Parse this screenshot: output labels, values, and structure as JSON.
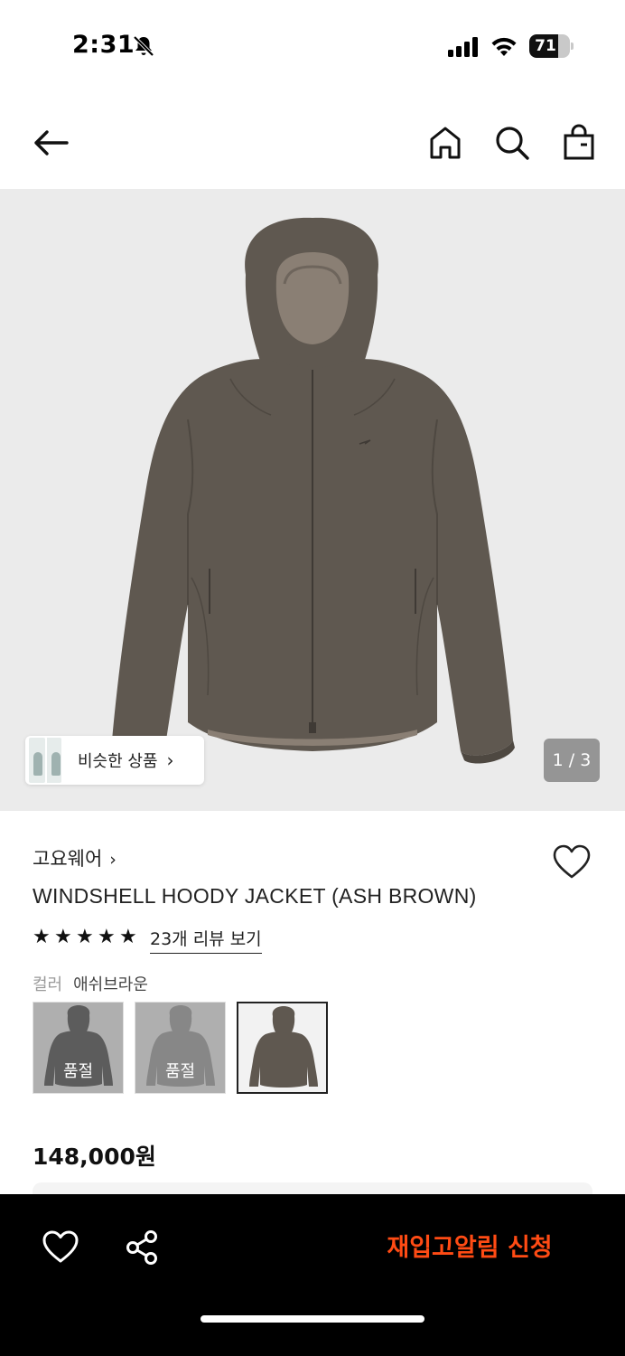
{
  "status_bar": {
    "time": "2:31",
    "battery_level": "71",
    "battery_fraction": 0.71
  },
  "nav": {
    "icons": [
      "back-arrow-icon",
      "home-icon",
      "search-icon",
      "shopping-bag-icon"
    ]
  },
  "hero": {
    "image_subject": "jacket-product-photo",
    "similar_label": "비슷한 상품",
    "similar_chevron": "›",
    "page_indicator": "1 / 3"
  },
  "product": {
    "brand": "고요웨어",
    "brand_chevron": "›",
    "name": "WINDSHELL HOODY JACKET (ASH BROWN)",
    "rating_stars": 5,
    "review_link": "23개 리뷰 보기",
    "color_label": "컬러",
    "color_value": "애쉬브라운",
    "swatches": [
      {
        "color": "#3a3a3a",
        "label": "품절",
        "sold_out": true
      },
      {
        "color": "#9a9a9a",
        "label": "품절",
        "sold_out": true
      },
      {
        "color": "#5f5850",
        "label": "",
        "sold_out": false
      }
    ],
    "price": "148,000원"
  },
  "bottom_bar": {
    "restock_label": "재입고알림 신청",
    "accent_color": "#ff4b14"
  },
  "colors": {
    "hero_bg": "#ebebeb",
    "jacket": "#5f5850"
  }
}
